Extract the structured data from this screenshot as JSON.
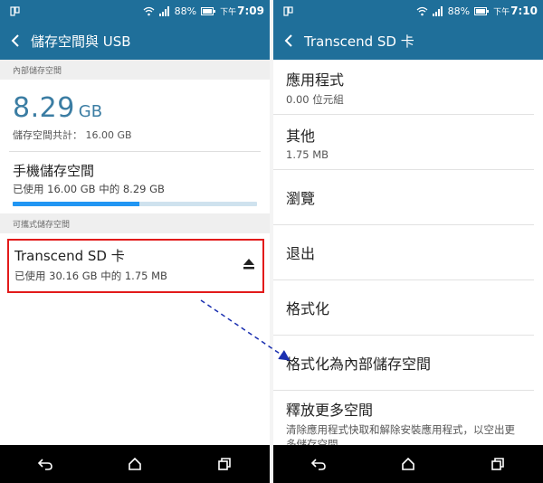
{
  "left": {
    "status": {
      "battery": "88%",
      "ampm": "下午",
      "time": "7:09"
    },
    "appbar": {
      "title": "儲存空間與 USB"
    },
    "internal_header": "內部儲存空間",
    "summary": {
      "value": "8.29",
      "unit": "GB",
      "total": "儲存空間共計： 16.00 GB"
    },
    "phone_storage": {
      "title": "手機儲存空間",
      "usage": "已使用 16.00 GB 中的 8.29 GB",
      "used_fraction": 0.52
    },
    "portable_header": "可攜式儲存空間",
    "sd_card": {
      "title": "Transcend SD 卡",
      "usage": "已使用 30.16 GB 中的 1.75 MB",
      "eject_icon": "eject-icon"
    }
  },
  "right": {
    "status": {
      "battery": "88%",
      "ampm": "下午",
      "time": "7:10"
    },
    "appbar": {
      "title": "Transcend SD 卡"
    },
    "items": [
      {
        "title": "應用程式",
        "sub": "0.00 位元組"
      },
      {
        "title": "其他",
        "sub": "1.75 MB"
      },
      {
        "title": "瀏覽",
        "sub": ""
      },
      {
        "title": "退出",
        "sub": ""
      },
      {
        "title": "格式化",
        "sub": ""
      },
      {
        "title": "格式化為內部儲存空間",
        "sub": ""
      },
      {
        "title": "釋放更多空間",
        "sub": "清除應用程式快取和解除安裝應用程式，以空出更多儲存空間"
      }
    ]
  },
  "colors": {
    "statusbar": "#1f6f9a",
    "accent": "#2196f3",
    "highlight": "#e21b1b",
    "arrow": "#1a2fb0"
  }
}
